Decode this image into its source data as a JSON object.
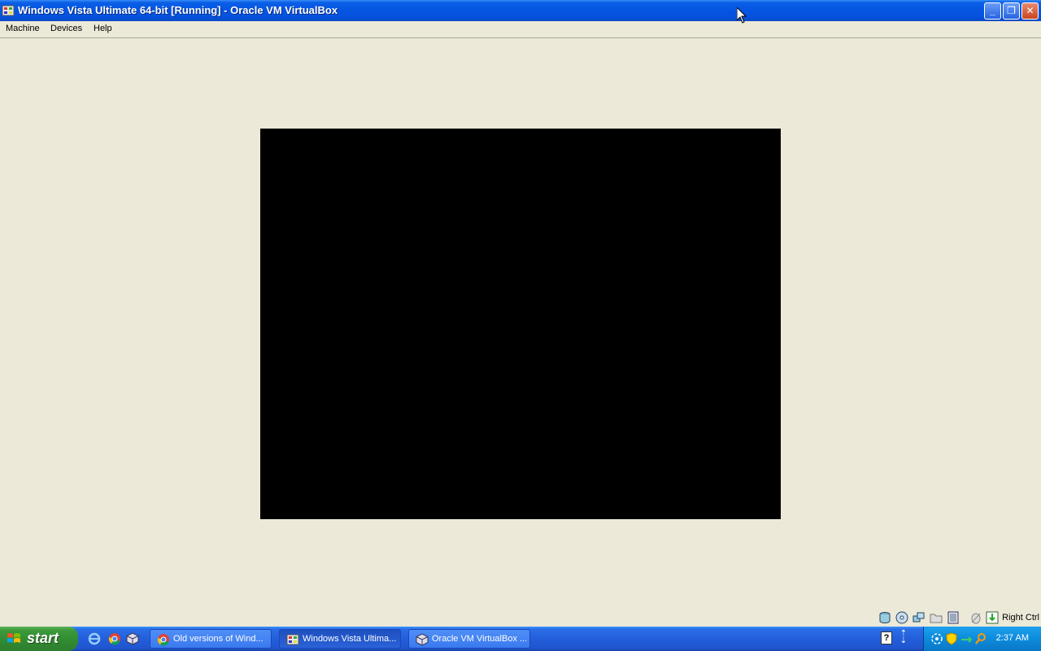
{
  "window": {
    "title": "Windows Vista Ultimate 64-bit [Running] - Oracle VM VirtualBox",
    "controls": {
      "minimize": "_",
      "restore": "❐",
      "close": "✕"
    }
  },
  "menu": {
    "items": [
      {
        "label": "Machine"
      },
      {
        "label": "Devices"
      },
      {
        "label": "Help"
      }
    ]
  },
  "vm_screen": {
    "state": "black screen"
  },
  "statusbar": {
    "icons": [
      "hard-disk-icon",
      "optical-drive-icon",
      "network-icon",
      "shared-folder-icon",
      "display-icon",
      "mouse-integration-icon",
      "host-key-icon"
    ],
    "host_key": "Right Ctrl"
  },
  "taskbar": {
    "start_label": "start",
    "quick_launch": [
      "ie-icon",
      "chrome-icon",
      "virtualbox-icon"
    ],
    "tasks": [
      {
        "label": "Old versions of Wind...",
        "icon": "chrome-icon"
      },
      {
        "label": "Windows Vista Ultima...",
        "icon": "vm-window-icon"
      },
      {
        "label": "Oracle VM VirtualBox ...",
        "icon": "virtualbox-icon"
      }
    ],
    "tray_icons": [
      "network-icon",
      "security-shield-icon",
      "arrow-icon",
      "search-icon"
    ],
    "clock": "2:37 AM"
  },
  "colors": {
    "titlebar": "#0554e2",
    "background": "#ece9d8",
    "taskbar": "#245edb",
    "start": "#318a31",
    "systray": "#0c8bdc"
  }
}
